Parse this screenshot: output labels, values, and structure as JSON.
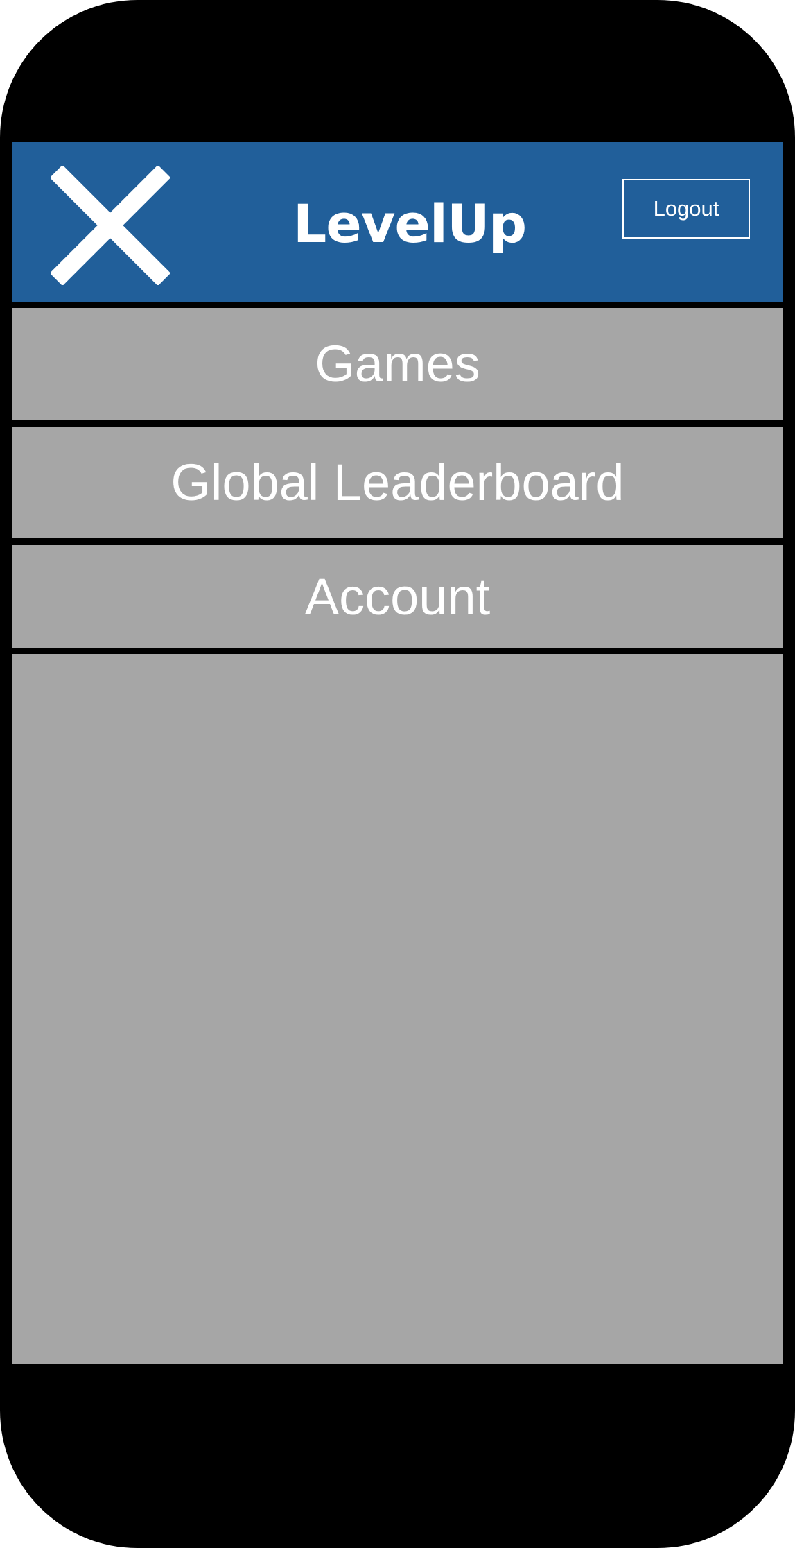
{
  "header": {
    "close_icon": "close-icon",
    "brand_name": "LevelUp",
    "logout_label": "Logout"
  },
  "menu": {
    "items": [
      {
        "label": "Games"
      },
      {
        "label": "Global Leaderboard"
      },
      {
        "label": "Account"
      }
    ]
  },
  "colors": {
    "header_bg": "#215f9a",
    "menu_bg": "#a6a6a6",
    "text": "#ffffff",
    "frame": "#000000"
  }
}
